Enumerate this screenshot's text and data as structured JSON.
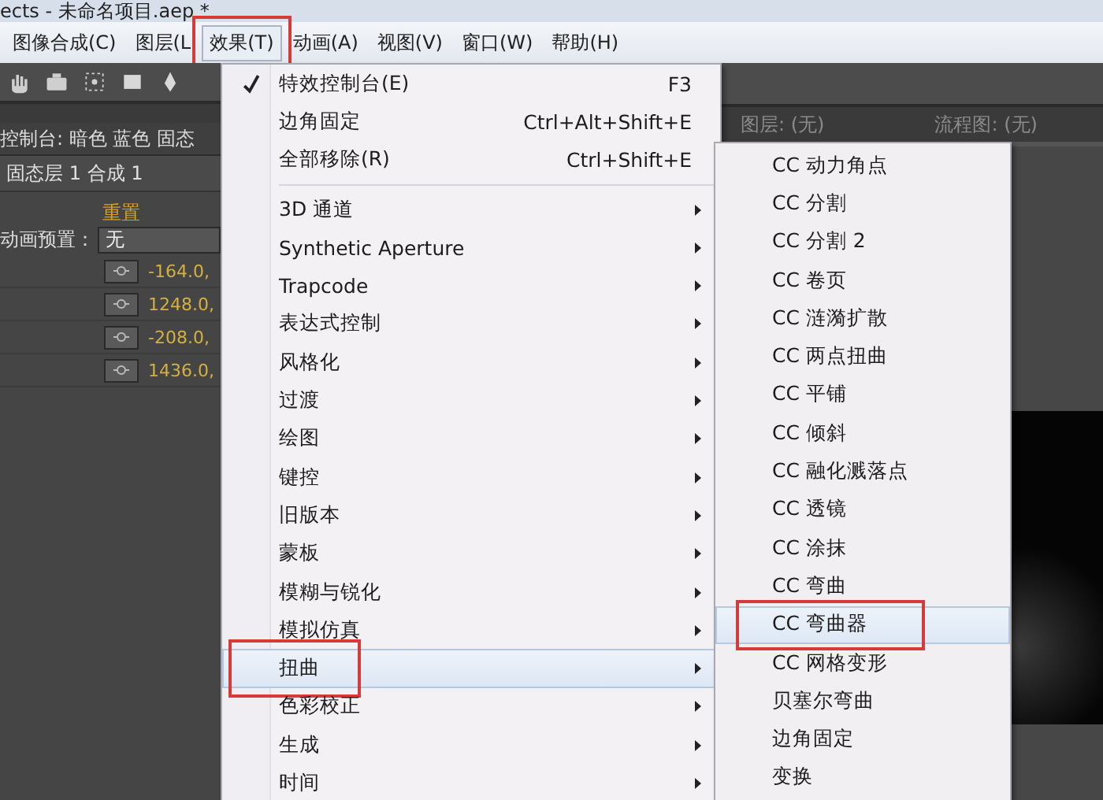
{
  "window": {
    "title": "ects - 未命名项目.aep *"
  },
  "menubar": [
    {
      "label": "图像合成(C)",
      "selected": false,
      "marked": false
    },
    {
      "label": "图层(L",
      "selected": false,
      "marked": false
    },
    {
      "label": "效果(T)",
      "selected": true,
      "marked": true
    },
    {
      "label": "动画(A)",
      "selected": false,
      "marked": false
    },
    {
      "label": "视图(V)",
      "selected": false,
      "marked": false
    },
    {
      "label": "窗口(W)",
      "selected": false,
      "marked": false
    },
    {
      "label": "帮助(H)",
      "selected": false,
      "marked": false
    }
  ],
  "effect_controls": {
    "header": "控制台: 暗色 蓝色 固态",
    "layer": "固态层 1 合成 1",
    "reset": "重置",
    "preset_label": "动画预置：",
    "preset_value": "无",
    "values": [
      "-164.0,",
      "1248.0,",
      "-208.0,",
      "1436.0,"
    ]
  },
  "viewer_tabs": [
    "图层: (无)",
    "流程图: (无)"
  ],
  "effect_menu": {
    "items": [
      {
        "kind": "command",
        "label": "特效控制台(E)",
        "shortcut": "F3",
        "checked": true,
        "highlighted": false,
        "marked": false
      },
      {
        "kind": "command",
        "label": "边角固定",
        "shortcut": "Ctrl+Alt+Shift+E",
        "checked": false,
        "highlighted": false,
        "marked": false
      },
      {
        "kind": "command",
        "label": "全部移除(R)",
        "shortcut": "Ctrl+Shift+E",
        "checked": false,
        "highlighted": false,
        "marked": false
      },
      {
        "kind": "separator"
      },
      {
        "kind": "submenu",
        "label": "3D 通道",
        "highlighted": false,
        "marked": false
      },
      {
        "kind": "submenu",
        "label": "Synthetic Aperture",
        "highlighted": false,
        "marked": false
      },
      {
        "kind": "submenu",
        "label": "Trapcode",
        "highlighted": false,
        "marked": false
      },
      {
        "kind": "submenu",
        "label": "表达式控制",
        "highlighted": false,
        "marked": false
      },
      {
        "kind": "submenu",
        "label": "风格化",
        "highlighted": false,
        "marked": false
      },
      {
        "kind": "submenu",
        "label": "过渡",
        "highlighted": false,
        "marked": false
      },
      {
        "kind": "submenu",
        "label": "绘图",
        "highlighted": false,
        "marked": false
      },
      {
        "kind": "submenu",
        "label": "键控",
        "highlighted": false,
        "marked": false
      },
      {
        "kind": "submenu",
        "label": "旧版本",
        "highlighted": false,
        "marked": false
      },
      {
        "kind": "submenu",
        "label": "蒙板",
        "highlighted": false,
        "marked": false
      },
      {
        "kind": "submenu",
        "label": "模糊与锐化",
        "highlighted": false,
        "marked": false
      },
      {
        "kind": "submenu",
        "label": "模拟仿真",
        "highlighted": false,
        "marked": false
      },
      {
        "kind": "submenu",
        "label": "扭曲",
        "highlighted": true,
        "marked": true
      },
      {
        "kind": "submenu",
        "label": "色彩校正",
        "highlighted": false,
        "marked": false
      },
      {
        "kind": "submenu",
        "label": "生成",
        "highlighted": false,
        "marked": false
      },
      {
        "kind": "submenu",
        "label": "时间",
        "highlighted": false,
        "marked": false
      }
    ]
  },
  "distort_menu": {
    "items": [
      {
        "label": "CC 动力角点",
        "highlighted": false,
        "marked": false
      },
      {
        "label": "CC 分割",
        "highlighted": false,
        "marked": false
      },
      {
        "label": "CC 分割 2",
        "highlighted": false,
        "marked": false
      },
      {
        "label": "CC 卷页",
        "highlighted": false,
        "marked": false
      },
      {
        "label": "CC 涟漪扩散",
        "highlighted": false,
        "marked": false
      },
      {
        "label": "CC 两点扭曲",
        "highlighted": false,
        "marked": false
      },
      {
        "label": "CC 平铺",
        "highlighted": false,
        "marked": false
      },
      {
        "label": "CC 倾斜",
        "highlighted": false,
        "marked": false
      },
      {
        "label": "CC 融化溅落点",
        "highlighted": false,
        "marked": false
      },
      {
        "label": "CC 透镜",
        "highlighted": false,
        "marked": false
      },
      {
        "label": "CC 涂抹",
        "highlighted": false,
        "marked": false
      },
      {
        "label": "CC 弯曲",
        "highlighted": false,
        "marked": false
      },
      {
        "label": "CC 弯曲器",
        "highlighted": true,
        "marked": true
      },
      {
        "label": "CC 网格变形",
        "highlighted": false,
        "marked": false
      },
      {
        "label": "贝塞尔弯曲",
        "highlighted": false,
        "marked": false
      },
      {
        "label": "边角固定",
        "highlighted": false,
        "marked": false
      },
      {
        "label": "变换",
        "highlighted": false,
        "marked": false
      }
    ]
  }
}
